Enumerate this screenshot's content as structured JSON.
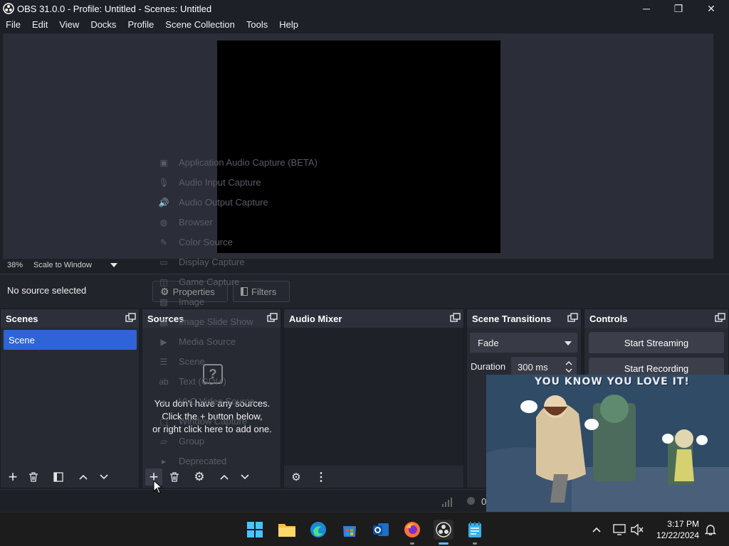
{
  "window": {
    "title": "OBS 31.0.0 - Profile: Untitled - Scenes: Untitled",
    "minimize": "─",
    "maximize": "❐",
    "close": "✕"
  },
  "menu": [
    "File",
    "Edit",
    "View",
    "Docks",
    "Profile",
    "Scene Collection",
    "Tools",
    "Help"
  ],
  "preview": {
    "zoom": "38%",
    "scale_mode": "Scale to Window"
  },
  "context_bar": {
    "no_source": "No source selected",
    "properties": "Properties",
    "filters": "Filters"
  },
  "add_source_menu": [
    {
      "label": "Application Audio Capture (BETA)",
      "icon": "app-audio-icon"
    },
    {
      "label": "Audio Input Capture",
      "icon": "microphone-icon"
    },
    {
      "label": "Audio Output Capture",
      "icon": "speaker-icon"
    },
    {
      "label": "Browser",
      "icon": "globe-icon"
    },
    {
      "label": "Color Source",
      "icon": "brush-icon"
    },
    {
      "label": "Display Capture",
      "icon": "monitor-icon"
    },
    {
      "label": "Game Capture",
      "icon": "gamepad-icon"
    },
    {
      "label": "Image",
      "icon": "image-icon"
    },
    {
      "label": "Image Slide Show",
      "icon": "slideshow-icon"
    },
    {
      "label": "Media Source",
      "icon": "play-icon"
    },
    {
      "label": "Scene",
      "icon": "list-icon"
    },
    {
      "label": "Text (GDI+)",
      "icon": "text-icon"
    },
    {
      "label": "VLC Video Source",
      "icon": "vlc-icon"
    },
    {
      "label": "Window Capture",
      "icon": "window-icon"
    },
    {
      "label": "Group",
      "icon": "folder-icon"
    },
    {
      "label": "Deprecated",
      "icon": "deprecated-icon"
    }
  ],
  "docks": {
    "scenes": {
      "title": "Scenes",
      "items": [
        "Scene"
      ]
    },
    "sources": {
      "title": "Sources",
      "empty_line1": "You don't have any sources.",
      "empty_line2": "Click the + button below,",
      "empty_line3": "or right click here to add one."
    },
    "audio_mixer": {
      "title": "Audio Mixer"
    },
    "transitions": {
      "title": "Scene Transitions",
      "selected": "Fade",
      "duration_label": "Duration",
      "duration_value": "300 ms"
    },
    "controls": {
      "title": "Controls",
      "start_streaming": "Start Streaming",
      "start_recording": "Start Recording"
    }
  },
  "overlay": {
    "caption": "YOU KNOW YOU LOVE IT!"
  },
  "status": {
    "frames": "0"
  },
  "taskbar": {
    "time": "3:17 PM",
    "date": "12/22/2024",
    "apps": [
      "start-icon",
      "file-explorer-icon",
      "edge-icon",
      "store-icon",
      "outlook-icon",
      "firefox-icon",
      "obs-icon",
      "notepad-icon"
    ]
  },
  "colors": {
    "accent": "#2f64d6",
    "panel": "#272a33",
    "background": "#1e2027"
  }
}
